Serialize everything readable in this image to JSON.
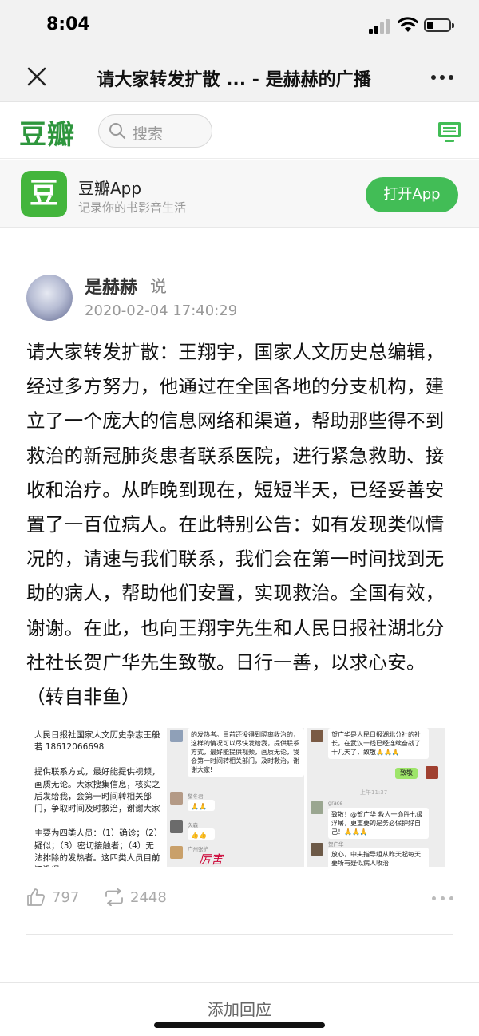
{
  "status_bar": {
    "time": "8:04"
  },
  "nav": {
    "title": "请大家转发扩散 ... - 是赫赫的广播"
  },
  "header": {
    "logo": "豆瓣",
    "search_placeholder": "搜索"
  },
  "banner": {
    "icon_char": "豆",
    "app_name": "豆瓣App",
    "app_desc": "记录你的书影音生活",
    "open_label": "打开App"
  },
  "post": {
    "author": "是赫赫",
    "said": "说",
    "date": "2020-02-04 17:40:29",
    "content": "请大家转发扩散：王翔宇，国家人文历史总编辑，经过多方努力，他通过在全国各地的分支机构，建立了一个庞大的信息网络和渠道，帮助那些得不到救治的新冠肺炎患者联系医院，进行紧急救助、接收和治疗。从昨晚到现在，短短半天，已经妥善安置了一百位病人。在此特别公告：如有发现类似情况的，请速与我们联系，我们会在第一时间找到无助的病人，帮助他们安置，实现救治。全国有效，谢谢。在此，也向王翔宇先生和人民日报社湖北分社社长贺广华先生致敬。日行一善，以求心安。（转自非鱼）"
  },
  "shots": {
    "shot1": "人民日报社国家人文历史杂志王般若 18612066698\n\n提供联系方式，最好能提供视频，画质无论。大家搜集信息，核实之后发给我，会第一时间转相关部门，争取时间及时救治，谢谢大家\n\n主要为四类人员：（1）确诊；（2）疑似；（3）密切接触者；（4）无法排除的发热者。这四类人员目前还没得",
    "shot2_bubble": "的发热者。目前还没得到隔离收治的，这样的情况可以尽快发给我，提供联系方式，最好能提供视频，画质无论，我会第一时间转相关部门，及时救治，谢谢大家!",
    "shot2_n1": "黎冬君",
    "shot2_n2": "久森",
    "shot2_n3": "广州张护",
    "shot2_red": "厉害",
    "shot3_bubble1": "贺广华是人民日报湖北分社的社长，在武汉一线已经连续奋战了十几天了，致敬🙏🙏🙏",
    "shot3_green": "致敬",
    "shot3_time": "上午11:37",
    "shot3_n1": "grace",
    "shot3_bubble2": "致敬！@贺广华 救人一命胜七级浮屠，更重要的是务必保护好自己！🙏🙏🙏",
    "shot3_n2": "贺广华",
    "shot3_bubble3": "放心，中央指导组从昨天起每天要所有疑似病人收治"
  },
  "actions": {
    "likes": "797",
    "reshares": "2448"
  },
  "bottom": {
    "reply_label": "添加回应"
  }
}
